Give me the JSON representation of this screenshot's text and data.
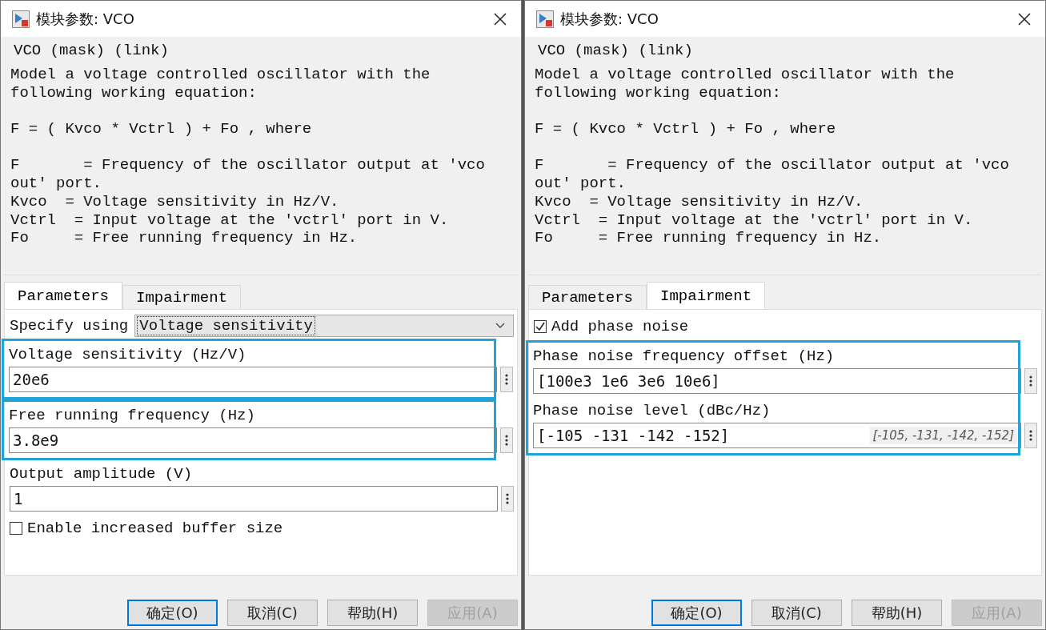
{
  "dialogs": [
    {
      "title": "模块参数: VCO",
      "group_title": "VCO (mask) (link)",
      "description": [
        [
          "Model a voltage controlled oscillator with the",
          "following working equation:"
        ],
        [
          "F = ( Kvco * Vctrl ) + Fo , where"
        ],
        [
          "F       = Frequency of the oscillator output at 'vco",
          "out' port.",
          "Kvco  = Voltage sensitivity in Hz/V.",
          "Vctrl  = Input voltage at the 'vctrl' port in V.",
          "Fo     = Free running frequency in Hz."
        ]
      ],
      "tabs": [
        {
          "label": "Parameters",
          "selected": true
        },
        {
          "label": "Impairment",
          "selected": false
        }
      ],
      "controls": [
        {
          "kind": "dropdown",
          "label": "Specify using",
          "value": "Voltage sensitivity"
        },
        {
          "kind": "group",
          "highlighted": true,
          "children": [
            {
              "kind": "field",
              "label": "Voltage sensitivity (Hz/V)",
              "value": "20e6"
            }
          ]
        },
        {
          "kind": "group",
          "highlighted": true,
          "children": [
            {
              "kind": "field",
              "label": "Free running frequency (Hz)",
              "value": "3.8e9"
            }
          ]
        },
        {
          "kind": "field",
          "label": "Output amplitude (V)",
          "value": "1"
        },
        {
          "kind": "checkbox",
          "label": "Enable increased buffer size",
          "checked": false
        }
      ],
      "buttons": [
        {
          "label": "确定(O)",
          "default": true,
          "disabled": false
        },
        {
          "label": "取消(C)",
          "default": false,
          "disabled": false
        },
        {
          "label": "帮助(H)",
          "default": false,
          "disabled": false
        },
        {
          "label": "应用(A)",
          "default": false,
          "disabled": true
        }
      ]
    },
    {
      "title": "模块参数: VCO",
      "group_title": "VCO (mask) (link)",
      "description": [
        [
          "Model a voltage controlled oscillator with the",
          "following working equation:"
        ],
        [
          "F = ( Kvco * Vctrl ) + Fo , where"
        ],
        [
          "F       = Frequency of the oscillator output at 'vco",
          "out' port.",
          "Kvco  = Voltage sensitivity in Hz/V.",
          "Vctrl  = Input voltage at the 'vctrl' port in V.",
          "Fo     = Free running frequency in Hz."
        ]
      ],
      "tabs": [
        {
          "label": "Parameters",
          "selected": false
        },
        {
          "label": "Impairment",
          "selected": true
        }
      ],
      "controls": [
        {
          "kind": "checkbox",
          "label": "Add phase noise",
          "checked": true
        },
        {
          "kind": "group",
          "highlighted": true,
          "children": [
            {
              "kind": "field",
              "label": "Phase noise frequency offset (Hz)",
              "value": "[100e3 1e6 3e6 10e6]"
            },
            {
              "kind": "field",
              "label": "Phase noise level (dBc/Hz)",
              "value": "[-105 -131 -142 -152]",
              "evaluated": "[-105, -131, -142, -152]"
            }
          ]
        }
      ],
      "buttons": [
        {
          "label": "确定(O)",
          "default": true,
          "disabled": false
        },
        {
          "label": "取消(C)",
          "default": false,
          "disabled": false
        },
        {
          "label": "帮助(H)",
          "default": false,
          "disabled": false
        },
        {
          "label": "应用(A)",
          "default": false,
          "disabled": true
        }
      ]
    }
  ]
}
